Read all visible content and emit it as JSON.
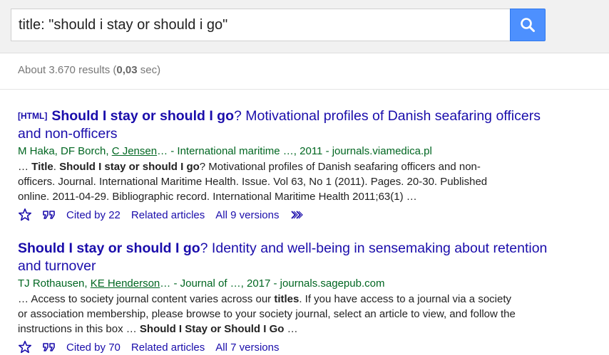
{
  "search": {
    "query": "title: \"should i stay or should i go\""
  },
  "stats": {
    "prefix": "About 3.670 results (",
    "time": "0,03",
    "suffix": " sec)"
  },
  "results": [
    {
      "tag": "[HTML]",
      "title_bold": "Should I stay or should I go",
      "title_rest": "? Motivational profiles of Danish seafaring officers and non-officers",
      "authors_plain": "M Haka, DF Borch, ",
      "authors_link": "C Jensen",
      "authors_rest": "… - International maritime …, 2011 - journals.viamedica.pl",
      "snippet": [
        {
          "t": "… ",
          "b": false
        },
        {
          "t": "Title",
          "b": true
        },
        {
          "t": ". ",
          "b": false
        },
        {
          "t": "Should I stay or should I go",
          "b": true
        },
        {
          "t": "? Motivational profiles of Danish seafaring officers and non-officers. Journal. International Maritime Health. Issue. Vol 63, No 1 (2011). Pages. 20-30. Published online. 2011-04-29. Bibliographic record. International Maritime Health 2011;63(1) …",
          "b": false
        }
      ],
      "cited_by": "Cited by 22",
      "related": "Related articles",
      "versions": "All 9 versions"
    },
    {
      "tag": "",
      "title_bold": "Should I stay or should I go",
      "title_rest": "? Identity and well-being in sensemaking about retention and turnover",
      "authors_plain": "TJ Rothausen, ",
      "authors_link": "KE Henderson",
      "authors_rest": "… - Journal of …, 2017 - journals.sagepub.com",
      "snippet": [
        {
          "t": "… Access to society journal content varies across our ",
          "b": false
        },
        {
          "t": "titles",
          "b": true
        },
        {
          "t": ". If you have access to a journal via a society or association membership, please browse to your society journal, select an article to view, and follow the instructions in this box … ",
          "b": false
        },
        {
          "t": "Should I Stay or Should I Go",
          "b": true
        },
        {
          "t": " …",
          "b": false
        }
      ],
      "cited_by": "Cited by 70",
      "related": "Related articles",
      "versions": "All 7 versions"
    }
  ],
  "icons": {
    "search": "search-icon",
    "save": "star-icon",
    "cite": "quote-icon",
    "more": "double-chevron-icon"
  },
  "colors": {
    "link": "#1a0dab",
    "meta": "#006621",
    "search_button": "#4d90fe"
  }
}
